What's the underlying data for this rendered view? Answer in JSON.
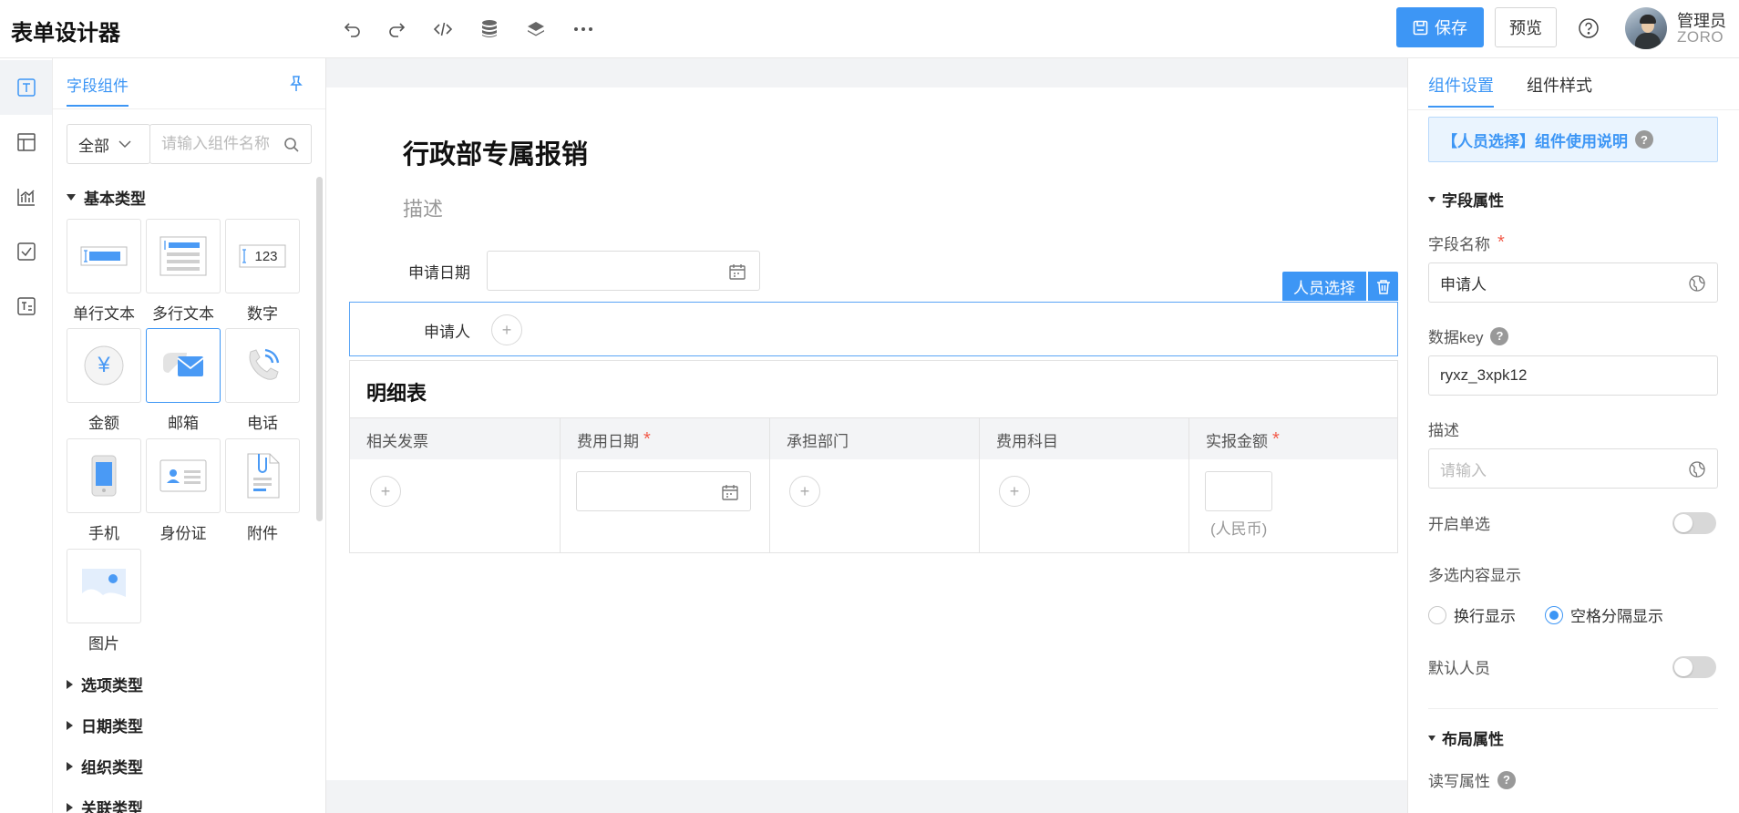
{
  "header": {
    "title": "表单设计器",
    "toolbar_icons": [
      "undo-icon",
      "redo-icon",
      "code-icon",
      "database-icon",
      "layers-icon",
      "more-icon"
    ],
    "save_label": "保存",
    "preview_label": "预览",
    "user_name": "管理员",
    "user_sub": "ZORO"
  },
  "rail": {
    "icons": [
      "text-field-icon",
      "layout-icon",
      "chart-icon",
      "checkbox-icon",
      "rich-text-icon"
    ],
    "active_index": 0
  },
  "components": {
    "tab_label": "字段组件",
    "filter_value": "全部",
    "search_placeholder": "请输入组件名称",
    "basic_category": "基本类型",
    "basic_items": [
      {
        "label": "单行文本",
        "icon": "single-line-text-icon"
      },
      {
        "label": "多行文本",
        "icon": "multi-line-text-icon"
      },
      {
        "label": "数字",
        "icon": "number-icon",
        "glyph": "123"
      },
      {
        "label": "金额",
        "icon": "currency-icon",
        "glyph": "¥"
      },
      {
        "label": "邮箱",
        "icon": "email-icon"
      },
      {
        "label": "电话",
        "icon": "phone-icon"
      },
      {
        "label": "手机",
        "icon": "mobile-icon"
      },
      {
        "label": "身份证",
        "icon": "id-card-icon"
      },
      {
        "label": "附件",
        "icon": "attachment-icon"
      },
      {
        "label": "图片",
        "icon": "image-icon"
      }
    ],
    "selected_item": "邮箱",
    "other_categories": [
      "选项类型",
      "日期类型",
      "组织类型",
      "关联类型"
    ]
  },
  "form": {
    "title": "行政部专属报销",
    "description": "描述",
    "date_field_label": "申请日期",
    "selected_field_tag": "人员选择",
    "applicant_label": "申请人",
    "detail_table": {
      "title": "明细表",
      "columns": [
        {
          "label": "相关发票",
          "required": false
        },
        {
          "label": "费用日期",
          "required": true
        },
        {
          "label": "承担部门",
          "required": false
        },
        {
          "label": "费用科目",
          "required": false
        },
        {
          "label": "实报金额",
          "required": true
        }
      ],
      "currency_unit": "(人民币)"
    }
  },
  "settings": {
    "tabs": [
      "组件设置",
      "组件样式"
    ],
    "active_tab": 0,
    "help_text": "【人员选择】组件使用说明",
    "field_section": "字段属性",
    "field_name_label": "字段名称",
    "field_name_value": "申请人",
    "data_key_label": "数据key",
    "data_key_value": "ryxz_3xpk12",
    "desc_label": "描述",
    "desc_placeholder": "请输入",
    "single_select_label": "开启单选",
    "single_select_on": false,
    "multi_display_label": "多选内容显示",
    "multi_display_options": [
      "换行显示",
      "空格分隔显示"
    ],
    "multi_display_selected": 1,
    "default_person_label": "默认人员",
    "default_person_on": false,
    "layout_section": "布局属性",
    "rw_label": "读写属性"
  },
  "colors": {
    "accent": "#3d96f5",
    "required": "#f25b4a",
    "canvas_bg": "#f2f3f5"
  }
}
